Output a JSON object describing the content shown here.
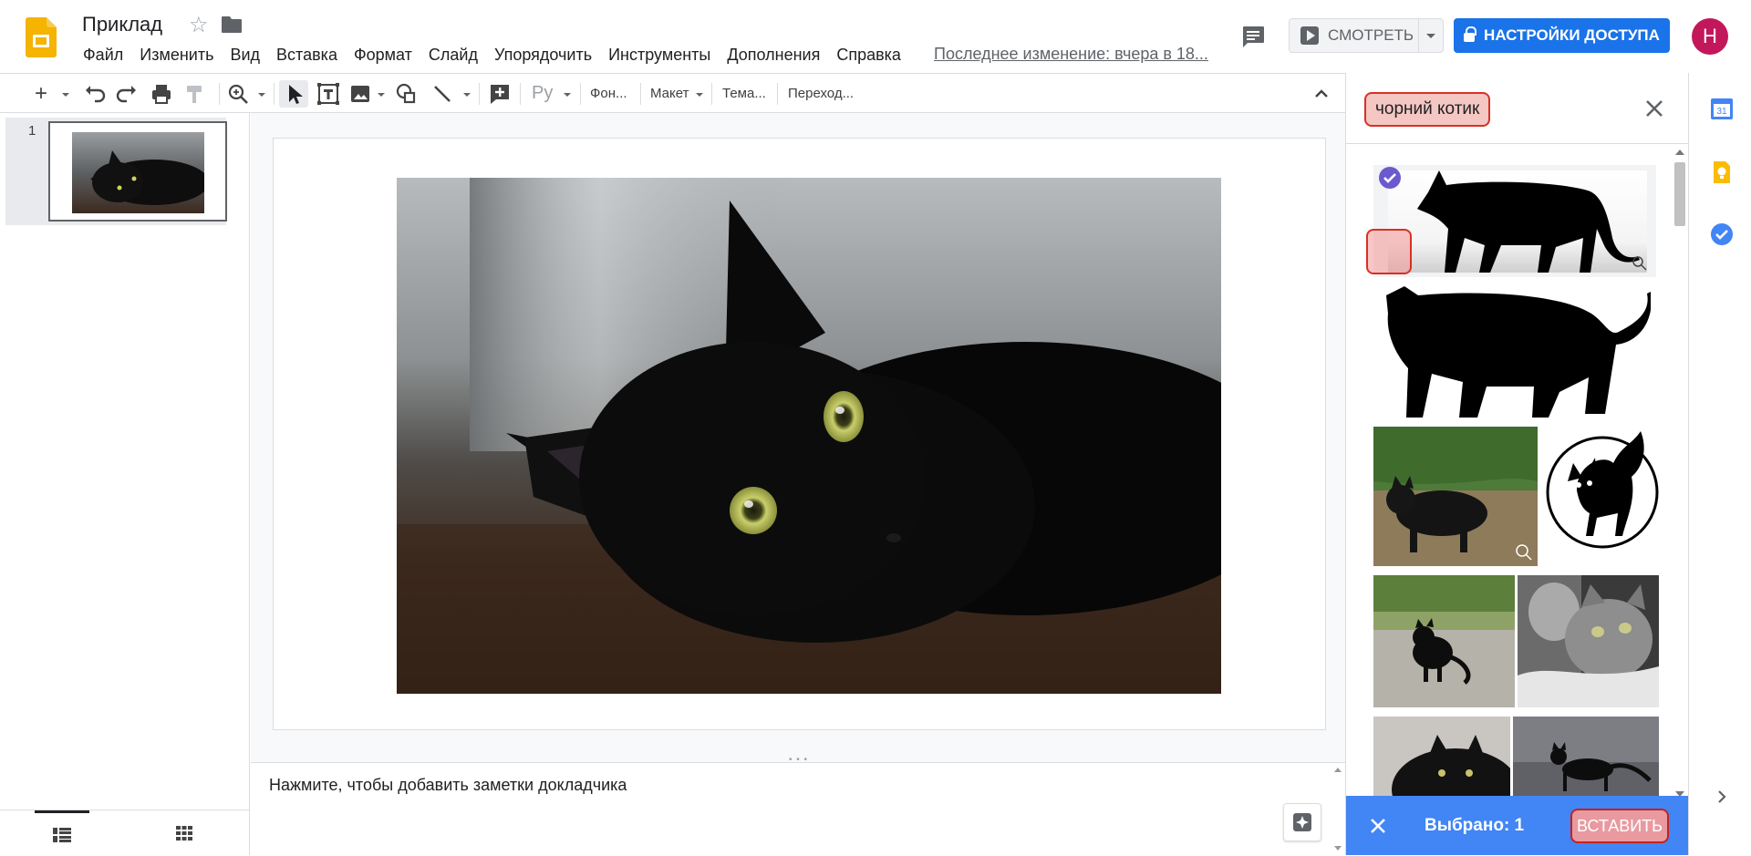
{
  "header": {
    "title": "Приклад",
    "menu": [
      "Файл",
      "Изменить",
      "Вид",
      "Вставка",
      "Формат",
      "Слайд",
      "Упорядочить",
      "Инструменты",
      "Дополнения",
      "Справка"
    ],
    "last_edit": "Последнее изменение: вчера в 18...",
    "present_label": "СМОТРЕТЬ",
    "share_label": "НАСТРОЙКИ ДОСТУПА",
    "avatar_letter": "Н"
  },
  "toolbar": {
    "language": "Ру",
    "background": "Фон...",
    "layout": "Макет",
    "theme": "Тема...",
    "transition": "Переход..."
  },
  "filmstrip": {
    "slide_number": "1"
  },
  "notes": {
    "placeholder": "Нажмите, чтобы добавить заметки докладчика"
  },
  "panel": {
    "search_query": "чорний котик",
    "selected_count": "Выбрано: 1",
    "insert_label": "ВСТАВИТЬ"
  },
  "colors": {
    "accent_blue": "#1a73e8",
    "action_bar": "#4285f4",
    "avatar": "#c2185b",
    "highlight_red": "#d93025"
  }
}
